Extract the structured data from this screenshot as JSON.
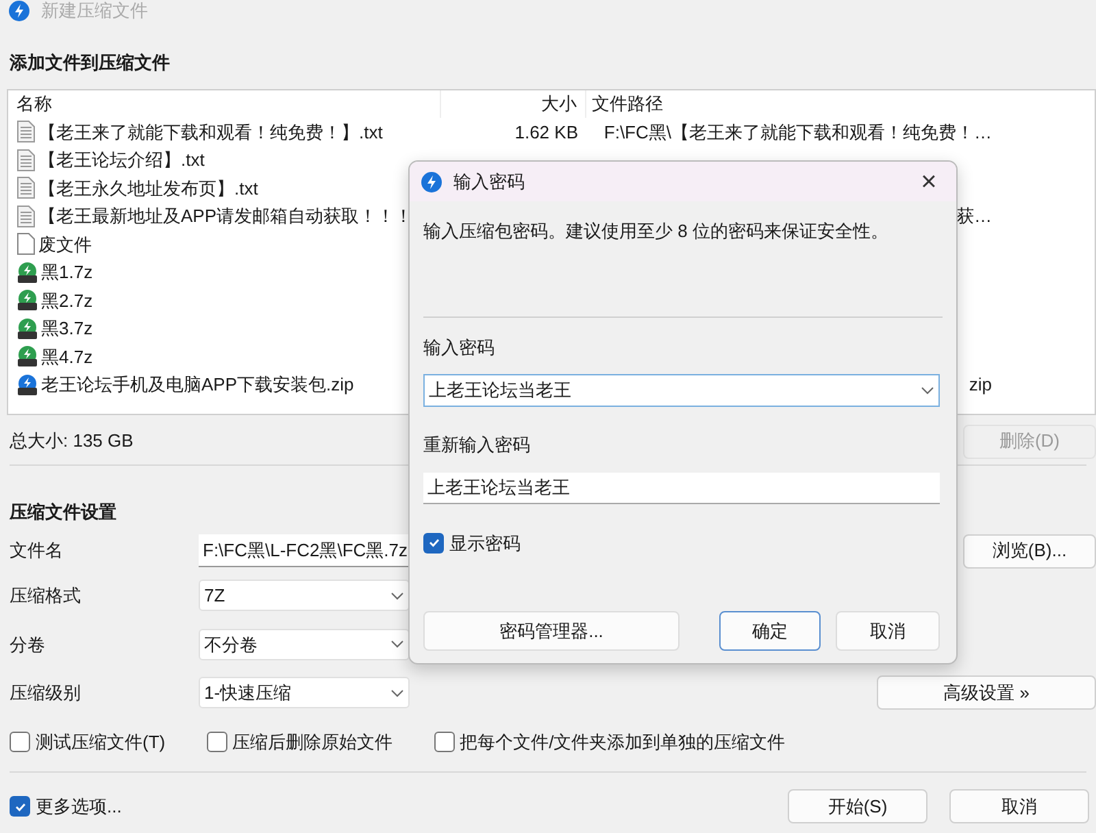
{
  "window": {
    "title": "新建压缩文件"
  },
  "heading": "添加文件到压缩文件",
  "table": {
    "columns": [
      "名称",
      "大小",
      "文件路径"
    ],
    "rows": [
      {
        "kind": "txt",
        "name": "【老王来了就能下载和观看！纯免费！】.txt",
        "size": "1.62 KB",
        "path": "F:\\FC黑\\【老王来了就能下载和观看！纯免费！…"
      },
      {
        "kind": "txt",
        "name": "【老王论坛介绍】.txt"
      },
      {
        "kind": "txt",
        "name": "【老王永久地址发布页】.txt"
      },
      {
        "kind": "txt",
        "name": "【老王最新地址及APP请发邮箱自动获取！！！",
        "path": "获…"
      },
      {
        "kind": "file",
        "name": "废文件"
      },
      {
        "kind": "sevenzip",
        "name": "黑1.7z"
      },
      {
        "kind": "sevenzip",
        "name": "黑2.7z"
      },
      {
        "kind": "sevenzip",
        "name": "黑3.7z"
      },
      {
        "kind": "sevenzip",
        "name": "黑4.7z"
      },
      {
        "kind": "zip",
        "name": "老王论坛手机及电脑APP下载安装包.zip",
        "path": "zip"
      }
    ]
  },
  "total": "总大小: 135 GB",
  "delete_button": {
    "label": "删除(D)",
    "disabled": true
  },
  "settings": {
    "heading": "压缩文件设置",
    "filename": {
      "label": "文件名",
      "value": "F:\\FC黑\\L-FC2黑\\FC黑.7z"
    },
    "browse_button": "浏览(B)...",
    "selects": [
      {
        "label": "压缩格式",
        "value": "7Z"
      },
      {
        "label": "分卷",
        "value": "不分卷"
      },
      {
        "label": "压缩级别",
        "value": "1-快速压缩"
      }
    ],
    "advanced_button": "高级设置 »",
    "options": [
      {
        "label": "测试压缩文件(T)",
        "checked": false
      },
      {
        "label": "压缩后删除原始文件",
        "checked": false
      },
      {
        "label": "把每个文件/文件夹添加到单独的压缩文件",
        "checked": false
      }
    ]
  },
  "more_options": {
    "label": "更多选项...",
    "checked": true
  },
  "buttons": [
    "开始(S)",
    "取消"
  ],
  "dialog": {
    "title": "输入密码",
    "close": "×",
    "message": "输入压缩包密码。建议使用至少 8 位的密码来保证安全性。",
    "password": {
      "label": "输入密码",
      "value": "上老王论坛当老王"
    },
    "confirm": {
      "label": "重新输入密码",
      "value": "上老王论坛当老王"
    },
    "show_password": {
      "label": "显示密码",
      "checked": true
    },
    "buttons": [
      {
        "label": "密码管理器...",
        "default": false
      },
      {
        "label": "确定",
        "default": true
      },
      {
        "label": "取消",
        "default": false
      }
    ]
  }
}
